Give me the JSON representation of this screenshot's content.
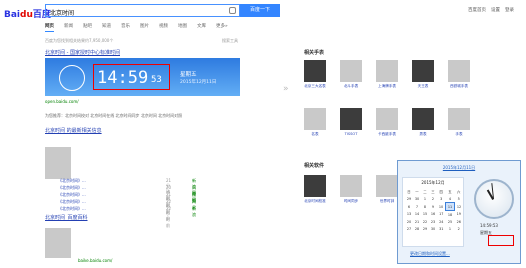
{
  "search": {
    "logo_main": "Bai",
    "logo_accent": "du",
    "logo_tail": "百度",
    "query": "北京时间",
    "button": "百度一下"
  },
  "top_links": [
    "百度首页",
    "设置",
    "登录"
  ],
  "tabs": [
    "网页",
    "新闻",
    "贴吧",
    "知道",
    "音乐",
    "图片",
    "视频",
    "地图",
    "文库",
    "更多»"
  ],
  "result_count": "百度为您找到相关结果约7,950,000个",
  "search_tools": "搜索工具",
  "result1": {
    "title": "北京时间 - 国家授时中心标准时间",
    "time": "14:59",
    "sec": "53",
    "weekday": "星期五",
    "date": "2015年12月11日",
    "url": "open.baidu.com/",
    "feedback": "为您推荐：北京时间校对 北京时间在线 北京时间同步 北京时间 北京时间对照"
  },
  "result2": {
    "title": "北京时间 的最新相关信息",
    "news": [
      {
        "text": "《北京时间》...",
        "date": "21分钟前",
        "src": "新浪网"
      },
      {
        "text": "《北京时间》...",
        "date": "20小时前",
        "src": "凤凰网"
      },
      {
        "text": "《北京时间》...",
        "date": "21小时前",
        "src": "搜狐"
      },
      {
        "text": "《北京时间》...",
        "date": "22小时前",
        "src": "网易"
      },
      {
        "text": "《北京时间》...",
        "date": "22小时前",
        "src": "新浪"
      }
    ]
  },
  "result3": {
    "title": "北京时间_百度百科",
    "url": "baike.baidu.com/"
  },
  "sidebar": {
    "heading1": "相关手表",
    "heading2": "相关软件",
    "items1": [
      "北京三大名表",
      "北斗手表",
      "上海牌手表",
      "天王表",
      "西铁城手表",
      "名表",
      "TISSOT",
      "卡西欧手表",
      "男表",
      "手表"
    ],
    "items2": [
      "北京时间校准",
      "时间同步",
      "世界时钟",
      "北京时区",
      "桌面时钟"
    ]
  },
  "popup": {
    "header": "2015年12月11日",
    "month": "2015年12月",
    "days": [
      "日",
      "一",
      "二",
      "三",
      "四",
      "五",
      "六"
    ],
    "weeks": [
      [
        "29",
        "30",
        "1",
        "2",
        "3",
        "4",
        "5"
      ],
      [
        "6",
        "7",
        "8",
        "9",
        "10",
        "11",
        "12"
      ],
      [
        "13",
        "14",
        "15",
        "16",
        "17",
        "18",
        "19"
      ],
      [
        "20",
        "21",
        "22",
        "23",
        "24",
        "25",
        "26"
      ],
      [
        "27",
        "28",
        "29",
        "30",
        "31",
        "1",
        "2"
      ]
    ],
    "today": "11",
    "time": "14:59:53",
    "weekday": "星期五",
    "link": "更改日期和时间设置..."
  }
}
